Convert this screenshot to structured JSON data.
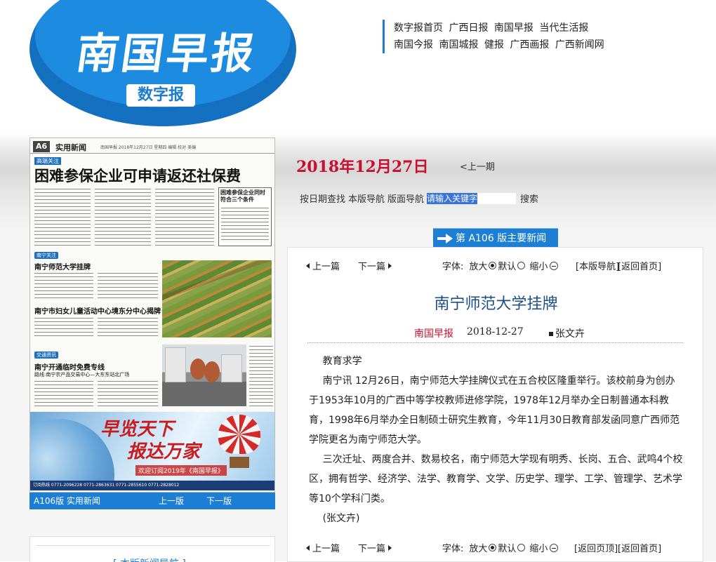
{
  "header": {
    "logo_title": "南国早报",
    "logo_badge": "数字报",
    "links_row1": [
      "数字报首页",
      "广西日报",
      "南国早报",
      "当代生活报"
    ],
    "links_row2": [
      "南国今报",
      "南国城报",
      "健报",
      "广西画报",
      "广西新闻网"
    ]
  },
  "issue": {
    "date": "2018年12月27日",
    "prev_issue": "<上一期"
  },
  "tools": {
    "date_search": "按日期查找",
    "page_nav": "本版导航",
    "layout_nav": "版面导航",
    "search_placeholder": "请输入关键字",
    "search_button": "搜索"
  },
  "section_tab": {
    "label": "第 A106 版主要新闻"
  },
  "newspaper_page": {
    "page_tag": "A6",
    "page_section": "实用新闻",
    "header_small": "南国早报  2018年12月27日  星期四  编辑 校对 美编",
    "headline_tag": "高端关注",
    "headline": "困难参保企业可申请返还社保费",
    "sidebox_title": "困难参保企业同时符合三个条件",
    "story1_tag": "南宁关注",
    "story1_title": "南宁师范大学挂牌",
    "story2_title": "南宁市妇女儿童活动中心境东分中心揭牌",
    "story3_tag": "交通资讯",
    "story3_title": "南宁开通临时免费专线",
    "story3_sub": "路线:南宁农产品交易中心—大东东站北广场",
    "ad_line1": "早览天下",
    "ad_line2": "报达万家",
    "ad_sub": "欢迎订阅2019年《南国早报》",
    "ad_strip": "订阅热线 0771-2096228  0771-2863631  0771-2855610  0771-2828012"
  },
  "page_pager": {
    "page_label": "A106版 实用新闻",
    "prev": "上一版",
    "next": "下一版"
  },
  "left_box2": {
    "title": "[ 本版新闻导航 ]"
  },
  "article_toolbar_top": {
    "prev": "上一篇",
    "next": "下一篇",
    "font_label": "字体:",
    "large": "放大",
    "default": "默认",
    "small": "缩小",
    "nav": "[本版导航]",
    "home": "[返回首页]"
  },
  "article_toolbar_bottom": {
    "prev": "上一篇",
    "next": "下一篇",
    "font_label": "字体:",
    "large": "放大",
    "default": "默认",
    "small": "缩小",
    "top": "[返回页顶]",
    "home": "[返回首页]"
  },
  "article": {
    "title": "南宁师范大学挂牌",
    "source": "南国早报",
    "date": "2018-12-27",
    "author": "张文卉",
    "paragraphs": [
      "教育求学",
      "南宁讯 12月26日，南宁师范大学挂牌仪式在五合校区隆重举行。该校前身为创办于1953年10月的广西中等学校教师进修学院，1978年12月举办全日制普通本科教育，1998年6月举办全日制硕士研究生教育，今年11月30日教育部发函同意广西师范学院更名为南宁师范大学。",
      "三次迁址、两度合并、数易校名，南宁师范大学现有明秀、长岗、五合、武鸣4个校区，拥有哲学、经济学、法学、教育学、文学、历史学、理学、工学、管理学、艺术学等10个学科门类。",
      "(张文卉)"
    ]
  }
}
